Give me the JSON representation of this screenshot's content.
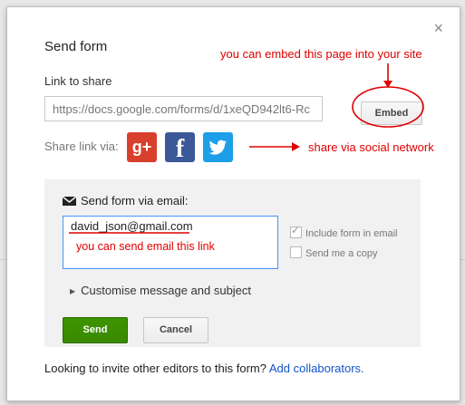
{
  "dialog": {
    "title": "Send form",
    "close_label": "×",
    "link_label": "Link to share",
    "link_value": "https://docs.google.com/forms/d/1xeQD942lt6-Rc",
    "embed_label": "Embed",
    "share_via_label": "Share link via:",
    "social": [
      {
        "name": "Google+",
        "glyph": "g+",
        "color": "#d93f2d"
      },
      {
        "name": "Facebook",
        "glyph": "f",
        "color": "#3b5998"
      },
      {
        "name": "Twitter",
        "glyph": "bird",
        "color": "#1d9ee8"
      }
    ],
    "email_section": {
      "heading": "Send form via email:",
      "to_value": "david_json@gmail.com",
      "include_label": "Include form in email",
      "include_checked": true,
      "copy_label": "Send me a copy",
      "copy_checked": false,
      "customise_label": "Customise message and subject",
      "send_label": "Send",
      "cancel_label": "Cancel"
    },
    "footer_text": "Looking to invite other editors to this form?",
    "footer_link": "Add collaborators."
  },
  "annotations": {
    "embed_note": "you can embed this page into your site",
    "social_note": "share via social network",
    "email_note": "you can send email this link",
    "color": "#e00000"
  },
  "colors": {
    "accent_link": "#1155cc",
    "send_button": "#3d9400",
    "field_focus": "#4d90fe"
  }
}
